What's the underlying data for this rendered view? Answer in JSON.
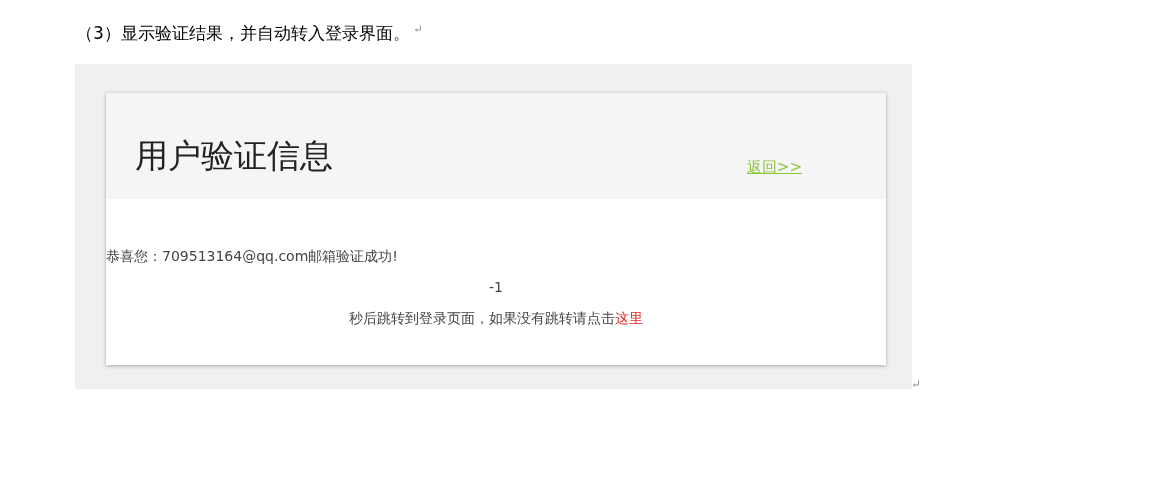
{
  "document": {
    "step_heading": "（3）显示验证结果，并自动转入登录界面。"
  },
  "embedded_page": {
    "title": "用户验证信息",
    "back_link": "返回>>",
    "success_message": "恭喜您：709513164@qq.com邮箱验证成功!",
    "countdown": "-1",
    "redirect_text": "秒后跳转到登录页面，如果没有跳转请点击",
    "redirect_link": "这里"
  }
}
